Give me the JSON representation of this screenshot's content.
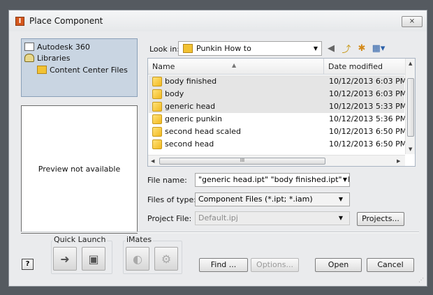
{
  "window": {
    "title": "Place Component",
    "app_icon": "I",
    "close_label": "⨯"
  },
  "places": [
    {
      "label": "Autodesk 360",
      "icon": "a360-icon"
    },
    {
      "label": "Libraries",
      "icon": "libraries-icon"
    },
    {
      "label": "Content Center Files",
      "icon": "folder-icon"
    }
  ],
  "preview": {
    "text": "Preview not available"
  },
  "look_in": {
    "label": "Look in:",
    "value": "Punkin How to"
  },
  "toolbar": {
    "back": "◀",
    "up": "⤴",
    "new_folder": "✱",
    "views": "▦▾"
  },
  "file_list": {
    "columns": {
      "name": "Name",
      "date": "Date modified"
    },
    "rows": [
      {
        "name": "body finished",
        "date": "10/12/2013 6:03 PM",
        "selected": true
      },
      {
        "name": "body",
        "date": "10/12/2013 6:03 PM",
        "selected": true
      },
      {
        "name": "generic head",
        "date": "10/12/2013 5:33 PM",
        "selected": true
      },
      {
        "name": "generic punkin",
        "date": "10/12/2013 5:36 PM",
        "selected": false
      },
      {
        "name": "second head scaled",
        "date": "10/12/2013 6:50 PM",
        "selected": false
      },
      {
        "name": "second head",
        "date": "10/12/2013 6:50 PM",
        "selected": false
      }
    ]
  },
  "file_name": {
    "label": "File name:",
    "value": "\"generic head.ipt\" \"body finished.ipt\" \"body.ip"
  },
  "files_of_type": {
    "label": "Files of type:",
    "value": "Component Files (*.ipt; *.iam)"
  },
  "project_file": {
    "label": "Project File:",
    "value": "Default.ipj"
  },
  "buttons": {
    "projects": "Projects...",
    "find": "Find ...",
    "options": "Options...",
    "open": "Open",
    "cancel": "Cancel",
    "help": "?"
  },
  "quick_launch": {
    "title": "Quick Launch"
  },
  "imates": {
    "title": "iMates"
  },
  "hscroll_glyph": "III"
}
